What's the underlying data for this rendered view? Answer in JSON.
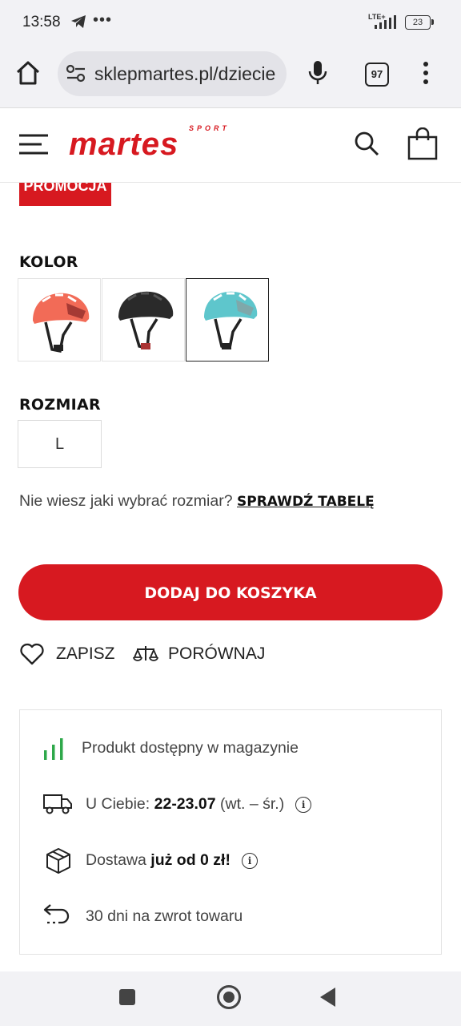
{
  "status": {
    "time": "13:58",
    "dots": "•••",
    "network": "LTE+",
    "battery": "23"
  },
  "browser": {
    "url": "sklepmartes.pl/dziecie",
    "tab_count": "97"
  },
  "header": {
    "logo_text": "martes",
    "logo_sub": "SPORT"
  },
  "promo": {
    "label": "PROMOCJA"
  },
  "color": {
    "label": "KOLOR",
    "options": [
      {
        "name": "coral",
        "hex": "#f26b57",
        "selected": false
      },
      {
        "name": "black",
        "hex": "#2a2a2a",
        "selected": false
      },
      {
        "name": "turquoise",
        "hex": "#5ec6cc",
        "selected": true
      }
    ]
  },
  "size": {
    "label": "ROZMIAR",
    "value": "L",
    "help_text": "Nie wiesz jaki wybrać rozmiar?",
    "help_link": "SPRAWDŹ TABELĘ"
  },
  "actions": {
    "add_to_cart": "DODAJ DO KOSZYKA",
    "save": "ZAPISZ",
    "compare": "PORÓWNAJ"
  },
  "info": {
    "stock": "Produkt dostępny w magazynie",
    "delivery_prefix": "U Ciebie:",
    "delivery_date": "22-23.07",
    "delivery_days": "(wt. – śr.)",
    "shipping_prefix": "Dostawa",
    "shipping_value": "już od 0 zł!",
    "returns": "30 dni na zwrot towaru"
  },
  "colors": {
    "brand_red": "#d71920",
    "stock_green": "#2ea84a"
  }
}
